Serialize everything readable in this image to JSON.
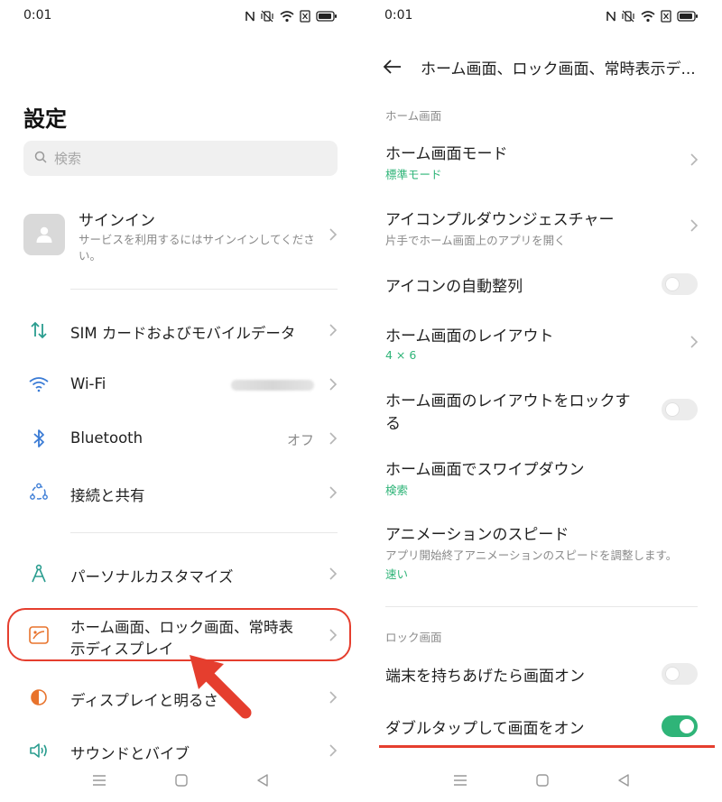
{
  "status_bar": {
    "time": "0:01"
  },
  "left_screen": {
    "title": "設定",
    "search": {
      "placeholder": "検索"
    },
    "signin": {
      "title": "サインイン",
      "description": "サービスを利用するにはサインインしてください。"
    },
    "items": [
      {
        "label": "SIM カードおよびモバイルデータ",
        "icon": "sim-data-icon"
      },
      {
        "label": "Wi-Fi",
        "icon": "wifi-icon"
      },
      {
        "label": "Bluetooth",
        "value": "オフ",
        "icon": "bluetooth-icon"
      },
      {
        "label": "接続と共有",
        "icon": "connection-share-icon"
      },
      {
        "label": "パーソナルカスタマイズ",
        "icon": "personalize-icon"
      },
      {
        "label": "ホーム画面、ロック画面、常時表示ディスプレイ",
        "label_line1": "ホーム画面、ロック画面、常時表",
        "label_line2": "示ディスプレイ",
        "icon": "home-screen-icon"
      },
      {
        "label": "ディスプレイと明るさ",
        "icon": "display-brightness-icon"
      },
      {
        "label": "サウンドとバイブ",
        "icon": "sound-icon"
      }
    ]
  },
  "right_screen": {
    "header_title": "ホーム画面、ロック画面、常時表示デ...",
    "sections": [
      {
        "label": "ホーム画面",
        "items": [
          {
            "title": "ホーム画面モード",
            "value": "標準モード",
            "control": "chevron"
          },
          {
            "title": "アイコンプルダウンジェスチャー",
            "subtitle": "片手でホーム画面上のアプリを開く",
            "control": "chevron"
          },
          {
            "title": "アイコンの自動整列",
            "control": "toggle",
            "checked": false
          },
          {
            "title": "ホーム画面のレイアウト",
            "value": "4 × 6",
            "control": "chevron"
          },
          {
            "title": "ホーム画面のレイアウトをロックする",
            "title_line1": "ホーム画面のレイアウトをロックす",
            "title_line2": "る",
            "control": "toggle",
            "checked": false
          },
          {
            "title": "ホーム画面でスワイプダウン",
            "value": "検索",
            "control": "none"
          },
          {
            "title": "アニメーションのスピード",
            "subtitle": "アプリ開始終了アニメーションのスピードを調整します。",
            "value": "速い",
            "control": "none"
          }
        ]
      },
      {
        "label": "ロック画面",
        "items": [
          {
            "title": "端末を持ちあげたら画面オン",
            "control": "toggle",
            "checked": false
          },
          {
            "title": "ダブルタップして画面をオン",
            "control": "toggle",
            "checked": true
          }
        ]
      }
    ]
  },
  "colors": {
    "accent_green": "#2fb478",
    "annotation_red": "#e53e2e",
    "text_primary": "#1f1f1f",
    "text_secondary": "#8a8a8a"
  }
}
